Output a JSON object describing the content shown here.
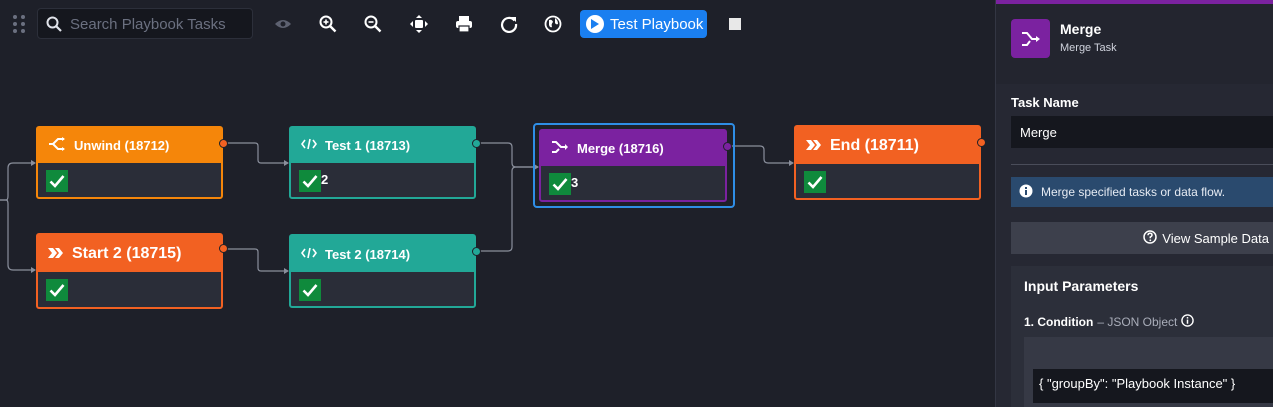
{
  "toolbar": {
    "search_placeholder": "Search Playbook Tasks",
    "test_playbook_label": "Test Playbook",
    "icons": [
      "drag-handle-icon",
      "eye-icon",
      "zoom-in-icon",
      "zoom-out-icon",
      "fit-screen-icon",
      "print-icon",
      "refresh-icon",
      "globe-icon",
      "play-icon",
      "stop-icon"
    ]
  },
  "colors": {
    "canvas_bg": "#1e2029",
    "unwind": "#f5860a",
    "test": "#22a897",
    "merge": "#7b22a0",
    "start": "#f26122",
    "end": "#f26122",
    "check": "#0f8a3c",
    "selection": "#2f8ee6",
    "primary_button": "#1a7ff0"
  },
  "nodes": {
    "unwind": {
      "title": "Unwind (18712)",
      "count": ""
    },
    "start2": {
      "title": "Start 2 (18715)",
      "count": ""
    },
    "test1": {
      "title": "Test 1 (18713)",
      "count": "2"
    },
    "test2": {
      "title": "Test 2 (18714)",
      "count": ""
    },
    "merge": {
      "title": "Merge (18716)",
      "count": "3"
    },
    "end": {
      "title": "End (18711)",
      "count": ""
    }
  },
  "panel": {
    "title": "Merge",
    "subtitle": "Merge Task",
    "task_name_label": "Task Name",
    "task_name_value": "Merge",
    "info_text": "Merge specified tasks or data flow.",
    "view_sample_label": "View Sample Data",
    "input_params_title": "Input Parameters",
    "condition_label": "1. Condition",
    "condition_type": "– JSON Object",
    "condition_value": "{ \"groupBy\": \"Playbook Instance\" }"
  }
}
